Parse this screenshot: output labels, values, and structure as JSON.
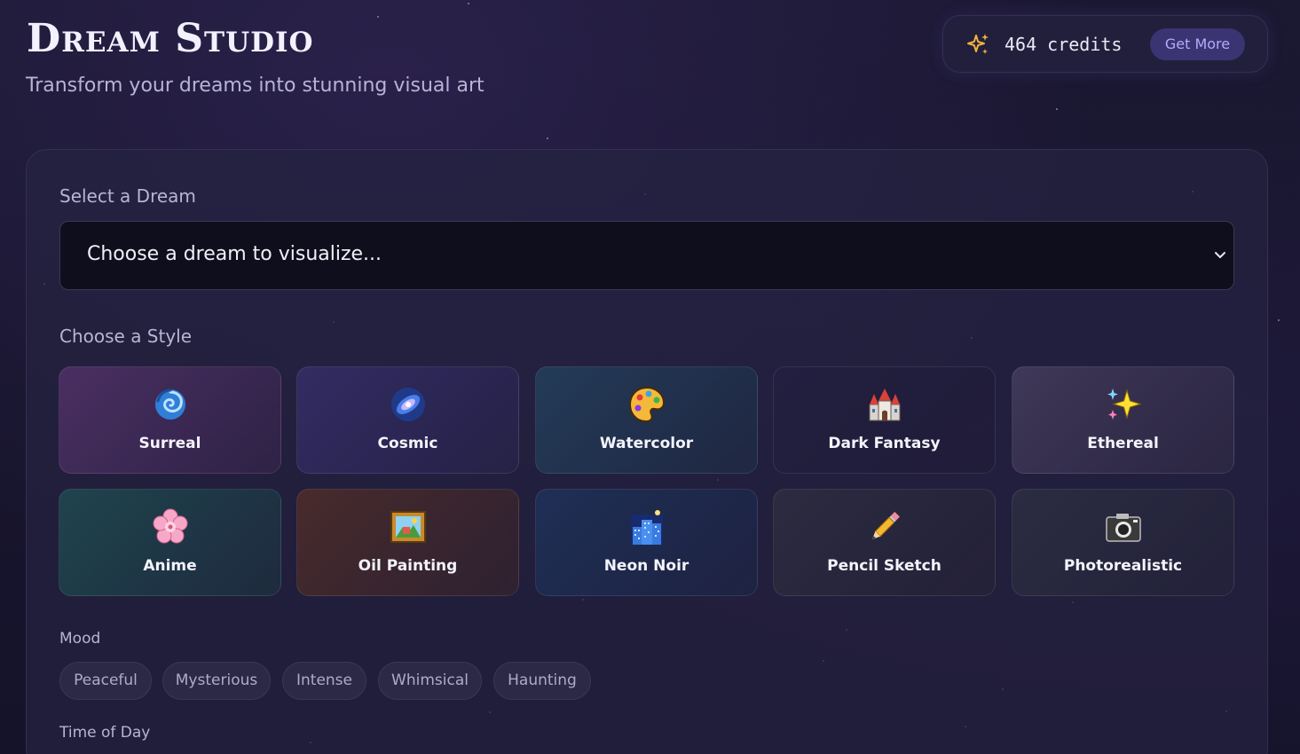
{
  "header": {
    "title": "Dream Studio",
    "subtitle": "Transform your dreams into stunning visual art"
  },
  "credits": {
    "icon": "sparkles-icon",
    "count_label": "464 credits",
    "get_more_label": "Get More"
  },
  "dream_select": {
    "label": "Select a Dream",
    "value": "Choose a dream to visualize..."
  },
  "styles": {
    "label": "Choose a Style",
    "items": [
      {
        "name": "Surreal",
        "icon": "cyclone-icon",
        "color": "#4a2f62"
      },
      {
        "name": "Cosmic",
        "icon": "galaxy-icon",
        "color": "#332c63"
      },
      {
        "name": "Watercolor",
        "icon": "palette-icon",
        "color": "#233b58"
      },
      {
        "name": "Dark Fantasy",
        "icon": "castle-icon",
        "color": "#231f40"
      },
      {
        "name": "Ethereal",
        "icon": "sparkles-icon",
        "color": "#3f3858"
      },
      {
        "name": "Anime",
        "icon": "cherry-blossom-icon",
        "color": "#1f444e"
      },
      {
        "name": "Oil Painting",
        "icon": "framed-picture-icon",
        "color": "#482b2c"
      },
      {
        "name": "Neon Noir",
        "icon": "city-night-icon",
        "color": "#1f2f56"
      },
      {
        "name": "Pencil Sketch",
        "icon": "pencil-icon",
        "color": "#2c2b40"
      },
      {
        "name": "Photorealistic",
        "icon": "camera-icon",
        "color": "#2b2c42"
      }
    ]
  },
  "mood": {
    "label": "Mood",
    "options": [
      "Peaceful",
      "Mysterious",
      "Intense",
      "Whimsical",
      "Haunting"
    ]
  },
  "time_of_day": {
    "label": "Time of Day"
  }
}
